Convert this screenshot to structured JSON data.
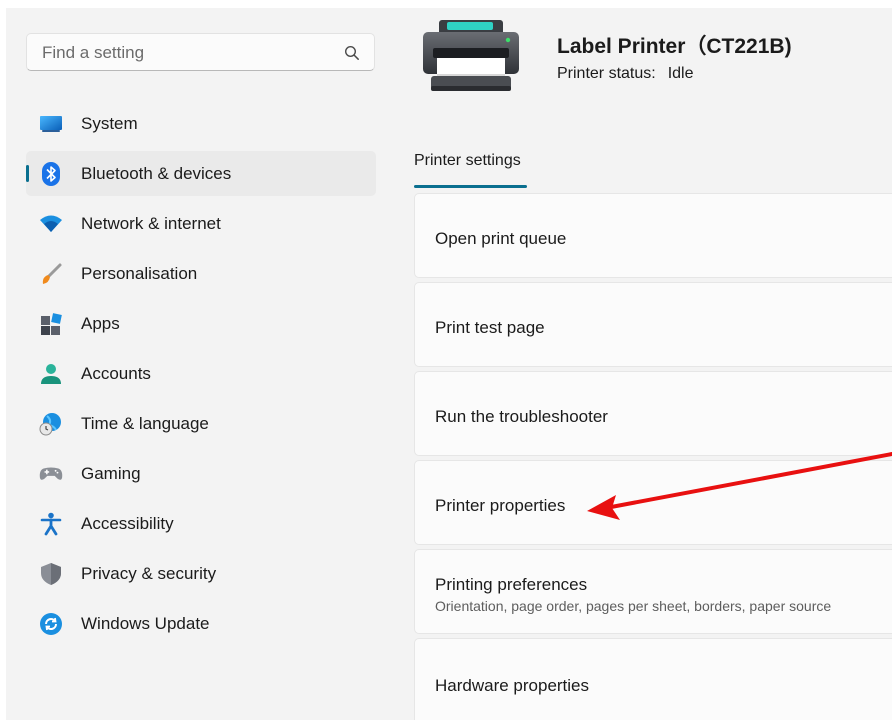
{
  "search": {
    "placeholder": "Find a setting",
    "icon": "search-icon"
  },
  "sidebar": {
    "items": [
      {
        "label": "System",
        "icon": "system-icon"
      },
      {
        "label": "Bluetooth & devices",
        "icon": "bluetooth-icon",
        "active": true
      },
      {
        "label": "Network & internet",
        "icon": "wifi-icon"
      },
      {
        "label": "Personalisation",
        "icon": "brush-icon"
      },
      {
        "label": "Apps",
        "icon": "apps-icon"
      },
      {
        "label": "Accounts",
        "icon": "account-icon"
      },
      {
        "label": "Time & language",
        "icon": "globe-clock-icon"
      },
      {
        "label": "Gaming",
        "icon": "gamepad-icon"
      },
      {
        "label": "Accessibility",
        "icon": "accessibility-icon"
      },
      {
        "label": "Privacy & security",
        "icon": "shield-icon"
      },
      {
        "label": "Windows Update",
        "icon": "update-icon"
      }
    ]
  },
  "header": {
    "printer_name": "Label Printer（CT221B)",
    "status_label": "Printer status:",
    "status_value": "Idle"
  },
  "tab": {
    "label": "Printer settings"
  },
  "cards": [
    {
      "title": "Open print queue"
    },
    {
      "title": "Print test page"
    },
    {
      "title": "Run the troubleshooter"
    },
    {
      "title": "Printer properties"
    },
    {
      "title": "Printing preferences",
      "subtitle": "Orientation, page order, pages per sheet, borders, paper source"
    },
    {
      "title": "Hardware properties"
    }
  ],
  "colors": {
    "accent": "#0a6f8f",
    "annotation_arrow": "#e81010"
  }
}
